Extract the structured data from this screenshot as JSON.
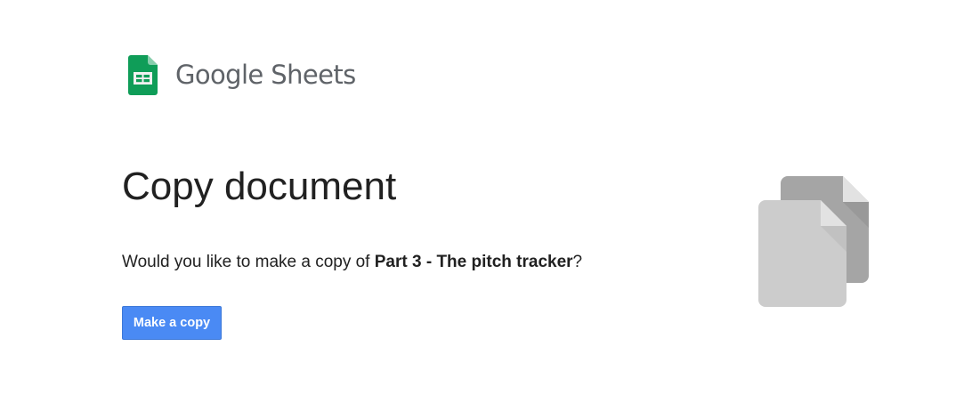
{
  "header": {
    "brand": "Google Sheets",
    "logo_icon": "google-sheets-icon",
    "logo_colors": {
      "primary": "#0f9d58",
      "fold": "#87ceac",
      "grid": "#f1f1f1"
    }
  },
  "main": {
    "title": "Copy document",
    "prompt_prefix": "Would you like to make a copy of ",
    "document_name": "Part 3 - The pitch tracker",
    "prompt_suffix": "?",
    "make_copy_label": "Make a copy"
  },
  "illustration": {
    "icon": "copy-documents-icon",
    "colors": {
      "back": "#a5a5a5",
      "front": "#cccccc",
      "fold": "#e2e2e2"
    }
  },
  "accent": "#4a8af4"
}
